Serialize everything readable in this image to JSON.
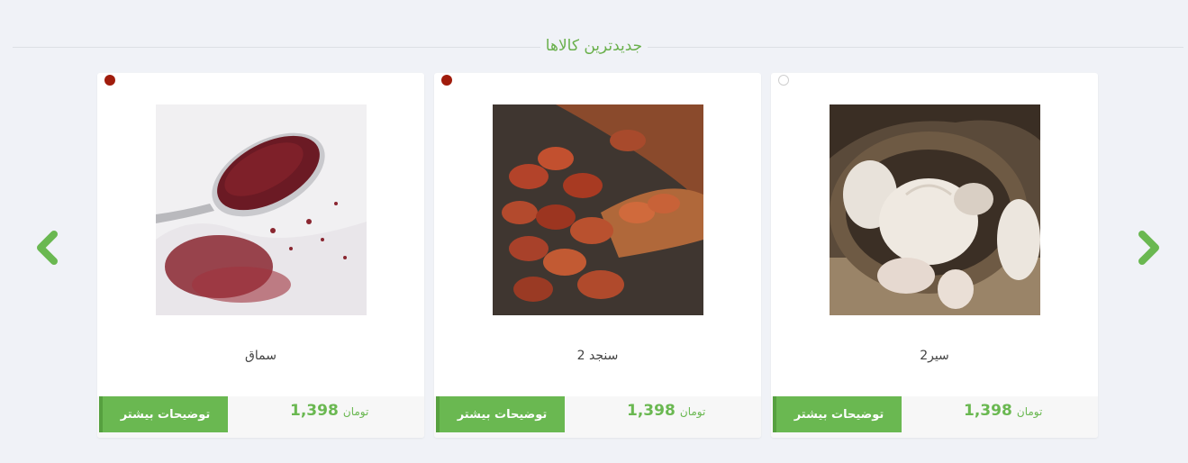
{
  "section": {
    "title": "جدیدترین کالاها"
  },
  "carousel": {
    "prev_icon": "chevron-left-icon",
    "next_icon": "chevron-right-icon",
    "accent": "#6ab851"
  },
  "products": [
    {
      "name": "سماق",
      "price": "1,398",
      "currency": "تومان",
      "button": "توضیحات بیشتر",
      "status": "filled",
      "image": "sumac"
    },
    {
      "name": "سنجد 2",
      "price": "1,398",
      "currency": "تومان",
      "button": "توضیحات بیشتر",
      "status": "filled",
      "image": "oleaster"
    },
    {
      "name": "سیر2",
      "price": "1,398",
      "currency": "تومان",
      "button": "توضیحات بیشتر",
      "status": "empty",
      "image": "garlic"
    }
  ]
}
